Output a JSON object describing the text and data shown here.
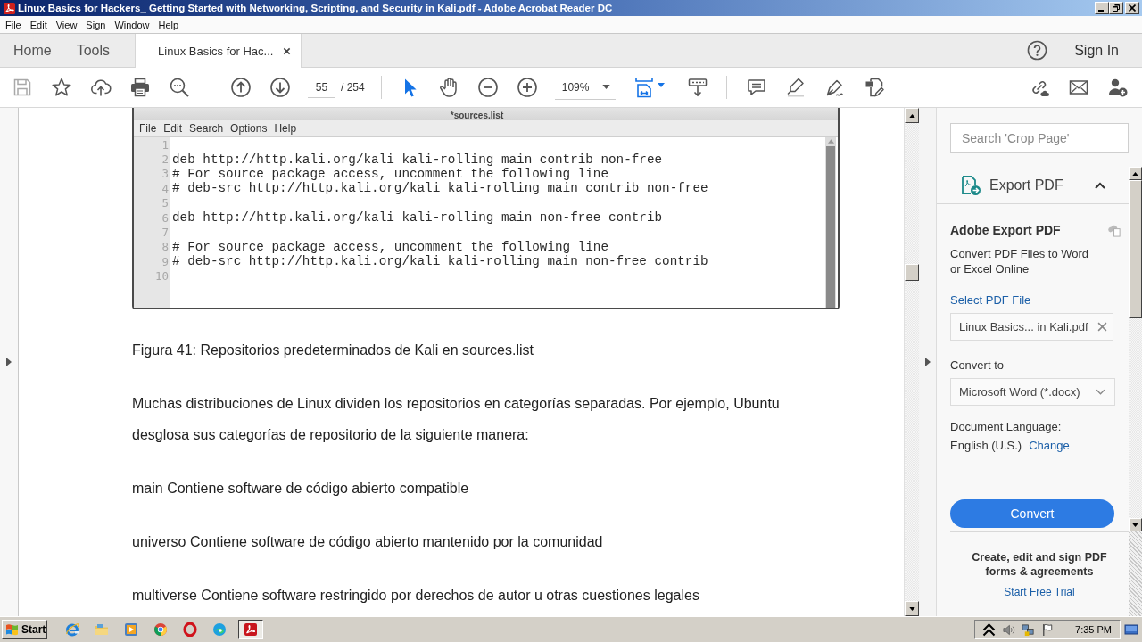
{
  "window": {
    "title": "Linux Basics for Hackers_ Getting Started with Networking, Scripting, and Security in Kali.pdf - Adobe Acrobat Reader DC"
  },
  "menu_bar": [
    "File",
    "Edit",
    "View",
    "Sign",
    "Window",
    "Help"
  ],
  "tabs": [
    {
      "label": "Home",
      "kind": "nav",
      "selected": false
    },
    {
      "label": "Tools",
      "kind": "nav",
      "selected": false
    },
    {
      "label": "Linux Basics for Hac...",
      "kind": "document",
      "selected": true
    }
  ],
  "header": {
    "sign_in": "Sign In"
  },
  "toolbar": {
    "page_number": "55",
    "page_count": "/ 254",
    "pointer_tools": [
      {
        "kind": "select",
        "selected": true
      },
      {
        "kind": "hand",
        "selected": false
      }
    ],
    "zoom": "109%"
  },
  "document": {
    "editor_screenshot": {
      "title": "*sources.list",
      "menu": [
        "File",
        "Edit",
        "Search",
        "Options",
        "Help"
      ],
      "lines": [
        {
          "number": "1"
        },
        {
          "number": "2",
          "code": "deb http://http.kali.org/kali kali-rolling main contrib non-free"
        },
        {
          "number": "3",
          "code": "# For source package access, uncomment the following line"
        },
        {
          "number": "4",
          "code": "# deb-src http://http.kali.org/kali kali-rolling main contrib non-free"
        },
        {
          "number": "5"
        },
        {
          "number": "6",
          "code": "deb http://http.kali.org/kali kali-rolling main non-free contrib"
        },
        {
          "number": "7"
        },
        {
          "number": "8",
          "code": "# For source package access, uncomment the following line"
        },
        {
          "number": "9",
          "code": "# deb-src http://http.kali.org/kali kali-rolling main non-free contrib"
        },
        {
          "number": "10"
        }
      ]
    },
    "caption": "Figura 41: Repositorios predeterminados de Kali en sources.list",
    "paragraphs": [
      "Muchas distribuciones de Linux dividen los repositorios en categorías separadas. Por ejemplo, Ubuntu desglosa sus categorías de repositorio de la siguiente manera:",
      "main Contiene software de código abierto compatible",
      "universo Contiene software de código abierto mantenido por la comunidad",
      "multiverse Contiene software restringido por derechos de autor u otras cuestiones legales"
    ]
  },
  "right_panel": {
    "search": {
      "placeholder": "Search 'Crop Page'"
    },
    "section": {
      "title": "Export PDF",
      "expanded": true
    },
    "heading": "Adobe Export PDF",
    "description": "Convert PDF Files to Word or Excel Online",
    "select_label": "Select PDF File",
    "file_field": {
      "value": "Linux Basics... in Kali.pdf"
    },
    "convert_to_label": "Convert to",
    "format_dropdown": {
      "value": "Microsoft Word (*.docx)"
    },
    "language_label": "Document Language:",
    "language_value": "English (U.S.)",
    "change_link": "Change",
    "convert_button": "Convert",
    "promo": {
      "text": "Create, edit and sign PDF forms & agreements",
      "link": "Start Free Trial"
    }
  },
  "taskbar": {
    "start": "Start",
    "apps": [
      {
        "kind": "ie",
        "selected": false
      },
      {
        "kind": "folder",
        "selected": false
      },
      {
        "kind": "media",
        "selected": false
      },
      {
        "kind": "chrome",
        "selected": false
      },
      {
        "kind": "opera",
        "selected": false
      },
      {
        "kind": "edge",
        "selected": false
      },
      {
        "kind": "acrobat",
        "selected": true
      }
    ],
    "clock": "7:35 PM"
  }
}
